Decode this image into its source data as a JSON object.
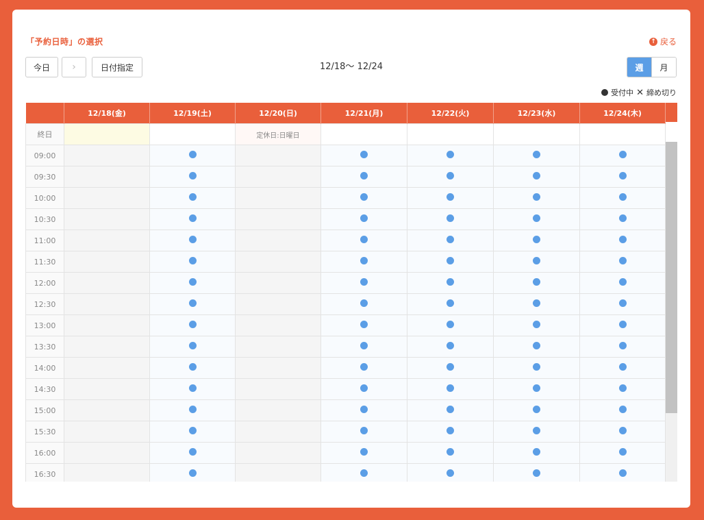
{
  "header": {
    "title": "「予約日時」の選択",
    "back_label": "戻る"
  },
  "toolbar": {
    "today_label": "今日",
    "next_icon": "›",
    "date_pick_label": "日付指定",
    "range_label": "12/18〜 12/24",
    "week_label": "週",
    "month_label": "月"
  },
  "legend": {
    "open_label": "受付中",
    "closed_label": "締め切り"
  },
  "calendar": {
    "days": [
      "12/18(金)",
      "12/19(土)",
      "12/20(日)",
      "12/21(月)",
      "12/22(火)",
      "12/23(水)",
      "12/24(木)"
    ],
    "allday_label": "終日",
    "holiday_text": "定休日:日曜日",
    "times": [
      "09:00",
      "09:30",
      "10:00",
      "10:30",
      "11:00",
      "11:30",
      "12:00",
      "12:30",
      "13:00",
      "13:30",
      "14:00",
      "14:30",
      "15:00",
      "15:30",
      "16:00",
      "16:30"
    ],
    "available_days": [
      1,
      3,
      4,
      5,
      6
    ]
  },
  "colors": {
    "brand": "#e95f3b",
    "available_dot": "#5b9ee6"
  }
}
